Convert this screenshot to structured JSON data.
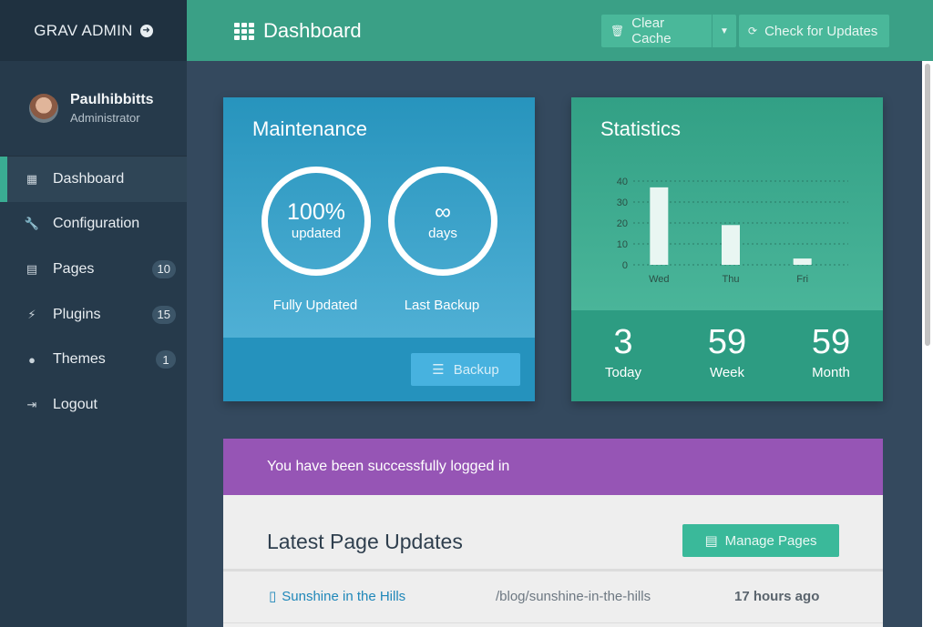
{
  "app": {
    "title": "GRAV ADMIN"
  },
  "user": {
    "name": "Paulhibbitts",
    "role": "Administrator"
  },
  "nav": [
    {
      "label": "Dashboard",
      "icon": "grid-icon",
      "badge": ""
    },
    {
      "label": "Configuration",
      "icon": "wrench-icon",
      "badge": ""
    },
    {
      "label": "Pages",
      "icon": "file-icon",
      "badge": "10"
    },
    {
      "label": "Plugins",
      "icon": "plug-icon",
      "badge": "15"
    },
    {
      "label": "Themes",
      "icon": "drop-icon",
      "badge": "1"
    },
    {
      "label": "Logout",
      "icon": "sign-out-icon",
      "badge": ""
    }
  ],
  "header": {
    "title": "Dashboard",
    "clear_cache": "Clear Cache",
    "check_updates": "Check for Updates"
  },
  "maintenance": {
    "title": "Maintenance",
    "updated_value": "100%",
    "updated_unit": "updated",
    "backup_value": "∞",
    "backup_unit": "days",
    "updated_label": "Fully Updated",
    "backup_label": "Last Backup",
    "backup_button": "Backup"
  },
  "statistics": {
    "title": "Statistics",
    "today_value": "3",
    "today_label": "Today",
    "week_value": "59",
    "week_label": "Week",
    "month_value": "59",
    "month_label": "Month"
  },
  "chart_data": {
    "type": "bar",
    "categories": [
      "Wed",
      "Thu",
      "Fri"
    ],
    "values": [
      37,
      19,
      3
    ],
    "ylim": [
      0,
      40
    ],
    "yticks": [
      0,
      10,
      20,
      30,
      40
    ],
    "grid": true,
    "title": "",
    "xlabel": "",
    "ylabel": ""
  },
  "alert": {
    "message": "You have been successfully logged in"
  },
  "updates": {
    "title": "Latest Page Updates",
    "manage_button": "Manage Pages",
    "rows": [
      {
        "title": "Sunshine in the Hills",
        "path": "/blog/sunshine-in-the-hills",
        "time": "17 hours ago"
      }
    ]
  },
  "colors": {
    "sidebar": "#263a4b",
    "header": "#3aa086",
    "maintenance": "#2794bd",
    "statistics": "#32a085",
    "alert": "#9655b5",
    "accent": "#3ab99a"
  }
}
